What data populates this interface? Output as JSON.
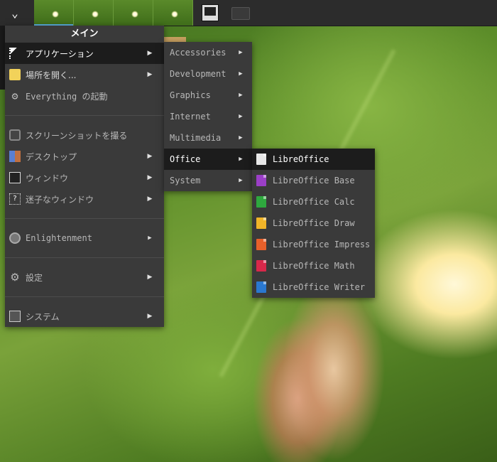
{
  "main_menu": {
    "title": "メイン",
    "items": [
      {
        "label": "アプリケーション",
        "icon": "apps-icon",
        "submenu": true
      },
      {
        "label": "場所を開く...",
        "icon": "folder-icon",
        "submenu": true
      },
      {
        "label": "Everything の起動",
        "icon": "gear-icon",
        "submenu": false
      },
      {
        "label": "スクリーンショットを撮る",
        "icon": "camera-icon",
        "submenu": false
      },
      {
        "label": "デスクトップ",
        "icon": "desktop-icon",
        "submenu": true
      },
      {
        "label": "ウィンドウ",
        "icon": "window-icon",
        "submenu": true
      },
      {
        "label": "迷子なウィンドウ",
        "icon": "lost-window-icon",
        "submenu": true
      },
      {
        "label": "Enlightenment",
        "icon": "enlightenment-icon",
        "submenu": true
      },
      {
        "label": "設定",
        "icon": "settings-gear-icon",
        "submenu": true
      },
      {
        "label": "システム",
        "icon": "system-icon",
        "submenu": true
      }
    ]
  },
  "applications_menu": {
    "items": [
      {
        "label": "Accessories"
      },
      {
        "label": "Development"
      },
      {
        "label": "Graphics"
      },
      {
        "label": "Internet"
      },
      {
        "label": "Multimedia"
      },
      {
        "label": "Office"
      },
      {
        "label": "System"
      }
    ],
    "selected": "Office"
  },
  "office_menu": {
    "items": [
      {
        "label": "LibreOffice",
        "icon": "libreoffice-icon"
      },
      {
        "label": "LibreOffice Base",
        "icon": "libreoffice-base-icon"
      },
      {
        "label": "LibreOffice Calc",
        "icon": "libreoffice-calc-icon"
      },
      {
        "label": "LibreOffice Draw",
        "icon": "libreoffice-draw-icon"
      },
      {
        "label": "LibreOffice Impress",
        "icon": "libreoffice-impress-icon"
      },
      {
        "label": "LibreOffice Math",
        "icon": "libreoffice-math-icon"
      },
      {
        "label": "LibreOffice Writer",
        "icon": "libreoffice-writer-icon"
      }
    ],
    "selected": "LibreOffice"
  },
  "colors": {
    "menu_bg": "#3a3a3a",
    "selected_bg": "#1c1c1c",
    "topbar_bg": "#2c2c2c",
    "text": "#d8d8d8"
  }
}
